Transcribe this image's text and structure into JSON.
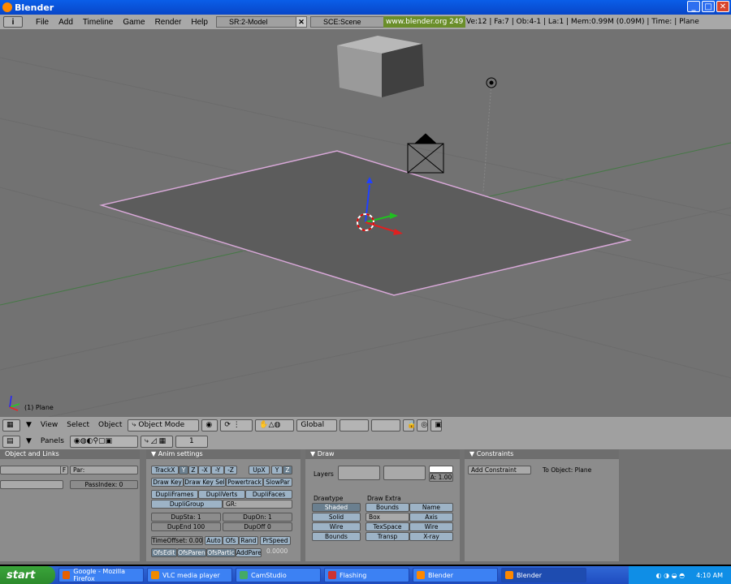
{
  "window": {
    "title": "Blender",
    "min_icon": "minimize-icon",
    "max_icon": "maximize-icon",
    "close_icon": "close-icon",
    "min": "_",
    "max": "□",
    "close": "✕"
  },
  "menubar": {
    "items": [
      "File",
      "Add",
      "Timeline",
      "Game",
      "Render",
      "Help"
    ],
    "screen_field": "SR:2-Model",
    "scene_field": "SCE:Scene",
    "info_label": "www.blender.org 249",
    "stats": "Ve:12 | Fa:7 | Ob:4-1 | La:1  | Mem:0.99M (0.09M)  | Time: | Plane"
  },
  "viewport": {
    "object_label": "(1) Plane"
  },
  "view_header": {
    "menus": [
      "View",
      "Select",
      "Object"
    ],
    "mode": "Object Mode",
    "orientation": "Global"
  },
  "buttons_header": {
    "panels_label": "Panels",
    "frame": "1"
  },
  "panels": {
    "object_links": {
      "title": "Object and Links",
      "f_btn": "F",
      "par_label": "Par:",
      "pass_index": "PassIndex: 0"
    },
    "anim": {
      "title": "Anim settings",
      "track": [
        "TrackX",
        "Y",
        "Z",
        "-X",
        "-Y",
        "-Z"
      ],
      "up": [
        "UpX",
        "Y",
        "Z"
      ],
      "row2": [
        "Draw Key",
        "Draw Key Sel",
        "Powertrack",
        "SlowPar"
      ],
      "row3": [
        "DupliFrames",
        "DupliVerts",
        "DupliFaces"
      ],
      "dupli_group": "DupliGroup",
      "gr_label": "GR:",
      "dupsta": "DupSta: 1",
      "dupon": "DupOn: 1",
      "dupend": "DupEnd 100",
      "dupoff": "DupOff 0",
      "time_offset": "TimeOffset: 0.00",
      "row7": [
        "Auto",
        "Ofs",
        "Rand",
        "PrSpeed"
      ],
      "row8": [
        "OfsEdit",
        "OfsParen",
        "OfsPartic",
        "AddPare"
      ],
      "speed_value": "0.0000"
    },
    "draw": {
      "title": "Draw",
      "layers_label": "Layers",
      "alpha": "A: 1.00",
      "drawtype_label": "Drawtype",
      "drawtypes": [
        "Shaded",
        "Solid",
        "Wire",
        "Bounds"
      ],
      "extra_label": "Draw Extra",
      "extra": [
        "Bounds",
        "Name",
        "Box",
        "Axis",
        "TexSpace",
        "Wire",
        "Transp",
        "X-ray"
      ]
    },
    "constraints": {
      "title": "Constraints",
      "add_btn": "Add Constraint",
      "to_object": "To Object: Plane"
    }
  },
  "taskbar": {
    "start": "start",
    "tasks": [
      {
        "label": "Google - Mozilla Firefox",
        "color": "#e66000"
      },
      {
        "label": "VLC media player",
        "color": "#f08a00"
      },
      {
        "label": "CamStudio",
        "color": "#4a6"
      },
      {
        "label": "Flashing",
        "color": "#c33"
      },
      {
        "label": "Blender",
        "color": "#f80"
      },
      {
        "label": "Blender",
        "color": "#f80"
      }
    ],
    "clock": "4:10 AM"
  }
}
